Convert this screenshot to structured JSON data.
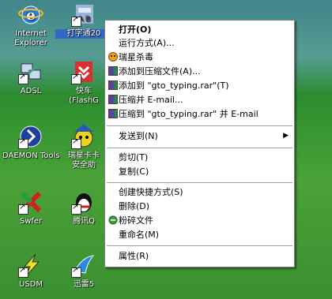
{
  "desktop": {
    "icons": [
      {
        "label": "Internet\nExplorer"
      },
      {
        "label": "打字通20"
      },
      {
        "label": "ADSL"
      },
      {
        "label": "快车\n(FlashG"
      },
      {
        "label": "DAEMON Tools"
      },
      {
        "label": "瑞星卡卡\n安全助"
      },
      {
        "label": "Swfer"
      },
      {
        "label": "腾讯Q"
      },
      {
        "label": "USDM"
      },
      {
        "label": "迅雷5"
      }
    ]
  },
  "context_menu": {
    "items": [
      {
        "label": "打开(O)",
        "bold": true
      },
      {
        "label": "运行方式(A)..."
      },
      {
        "label": "瑞星杀毒",
        "icon": "rising-antivirus-icon"
      },
      {
        "label": "添加到压缩文件(A)...",
        "icon": "winrar-icon"
      },
      {
        "label": "添加到 \"gto_typing.rar\"(T)",
        "icon": "winrar-icon"
      },
      {
        "label": "压缩并 E-mail...",
        "icon": "winrar-icon"
      },
      {
        "label": "压缩到 \"gto_typing.rar\" 并 E-mail",
        "icon": "winrar-icon"
      },
      {
        "label": "发送到(N)",
        "submenu": true
      },
      {
        "label": "剪切(T)"
      },
      {
        "label": "复制(C)"
      },
      {
        "label": "创建快捷方式(S)"
      },
      {
        "label": "删除(D)"
      },
      {
        "label": "粉碎文件",
        "icon": "shred-icon"
      },
      {
        "label": "重命名(M)"
      },
      {
        "label": "属性(R)"
      }
    ],
    "submenu_arrow": "▶"
  },
  "colors": {
    "selection": "#316ac5",
    "menu_bg": "#ffffff",
    "separator": "#a0a0a0"
  }
}
